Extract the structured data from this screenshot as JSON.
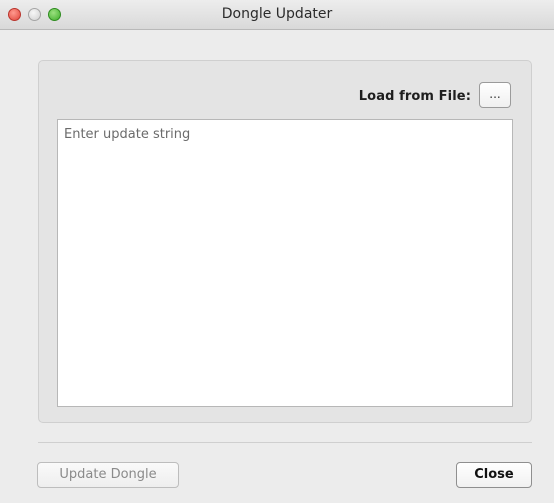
{
  "window": {
    "title": "Dongle Updater"
  },
  "file_loader": {
    "label": "Load from File:",
    "button_label": "..."
  },
  "update_field": {
    "placeholder": "Enter update string",
    "value": ""
  },
  "footer": {
    "update_button": "Update Dongle",
    "close_button": "Close"
  },
  "colors": {
    "close_traffic": "#e0443a",
    "maximize_traffic": "#3fae2b",
    "window_bg": "#ececec"
  },
  "icons": {
    "close": "close-traffic-light-icon",
    "minimize": "minimize-traffic-light-icon",
    "maximize": "maximize-traffic-light-icon"
  }
}
